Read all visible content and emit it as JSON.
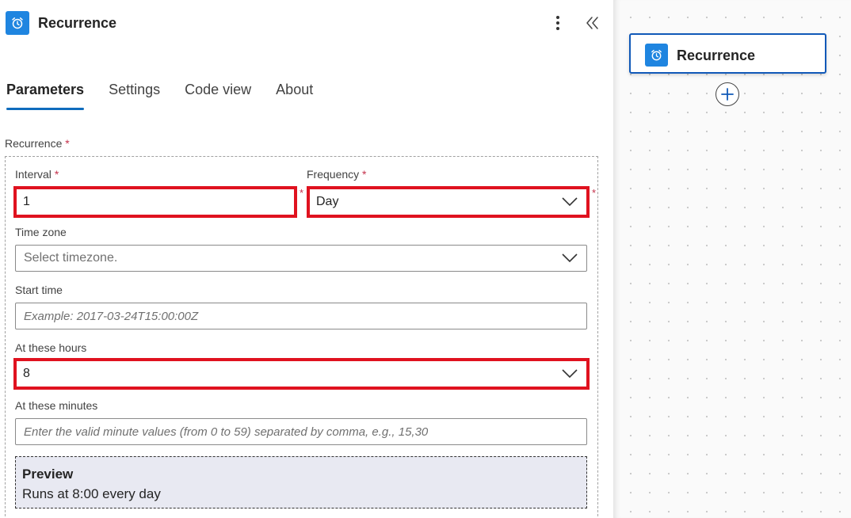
{
  "header": {
    "title": "Recurrence",
    "icon": "alarm-clock-icon"
  },
  "tabs": [
    {
      "label": "Parameters",
      "active": true
    },
    {
      "label": "Settings",
      "active": false
    },
    {
      "label": "Code view",
      "active": false
    },
    {
      "label": "About",
      "active": false
    }
  ],
  "section": {
    "label": "Recurrence",
    "required_mark": "*"
  },
  "fields": {
    "interval": {
      "label": "Interval",
      "value": "1",
      "required_mark": "*"
    },
    "frequency": {
      "label": "Frequency",
      "value": "Day",
      "required_mark": "*"
    },
    "time_zone": {
      "label": "Time zone",
      "placeholder": "Select timezone."
    },
    "start_time": {
      "label": "Start time",
      "placeholder": "Example: 2017-03-24T15:00:00Z"
    },
    "at_hours": {
      "label": "At these hours",
      "value": "8"
    },
    "at_minutes": {
      "label": "At these minutes",
      "placeholder": "Enter the valid minute values (from 0 to 59) separated by comma, e.g., 15,30"
    }
  },
  "preview": {
    "title": "Preview",
    "text": "Runs at 8:00 every day"
  },
  "canvas": {
    "node_title": "Recurrence",
    "node_icon": "alarm-clock-icon"
  },
  "colors": {
    "accent": "#1f85e0",
    "highlight": "#e0121f",
    "tab_underline": "#0f6cbd"
  }
}
